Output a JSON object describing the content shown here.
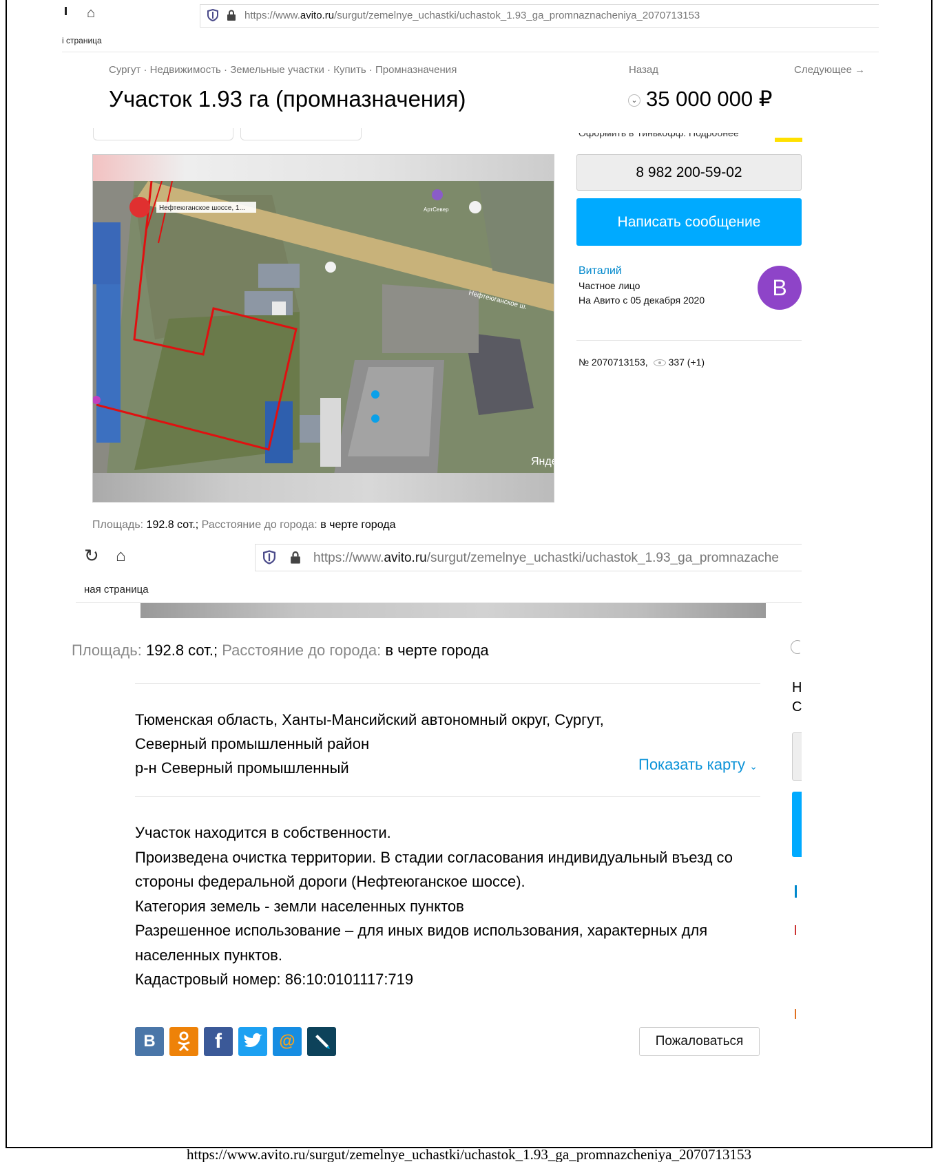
{
  "top": {
    "url_prefix": "https://www.",
    "url_host": "avito.ru",
    "url_path": "/surgut/zemelnye_uchastki/uchastok_1.93_ga_promnaznacheniya_2070713153",
    "bookmark": "і страница",
    "breadcrumb": "Сургут · Недвижимость · Земельные участки · Купить · Промназначения",
    "nav_back": "Назад",
    "nav_next": "Следующее →",
    "title": "Участок 1.93 га (промназначения)",
    "price": "35 000 000 ₽",
    "phone_button": "8 982 200-59-02",
    "message_button": "Написать сообщение",
    "seller_name": "Виталий",
    "seller_type": "Частное лицо",
    "seller_since": "На Авито с 05 декабря 2020",
    "ad_number": "№ 2070713153,",
    "views": "337 (+1)",
    "partial_text": "Оформить в Тинькофф. Подробнее",
    "avatar_letter": "В",
    "map_labels": {
      "place": "Нефтеюганское шоссе, 1...",
      "road": "Нефтеюганское ш.",
      "arts": "АртСевер",
      "watermark": "Янде"
    }
  },
  "params": {
    "area_label": "Площадь:",
    "area_value": "192.8 сот.",
    "sep": ";",
    "distance_label": "Расстояние до города:",
    "distance_value": "в черте города"
  },
  "bottom": {
    "url_prefix": "https://www.",
    "url_host": "avito.ru",
    "url_path": "/surgut/zemelnye_uchastki/uchastok_1.93_ga_promnazache",
    "bookmark": "ная страница",
    "address_lines": [
      "Тюменская область, Ханты-Мансийский автономный округ, Сургут,",
      "Северный промышленный район",
      "р-н Северный промышленный"
    ],
    "show_map": "Показать карту",
    "description_lines": [
      "Участок находится в собственности.",
      "Произведена очистка территории. В стадии согласования индивидуальный въезд со",
      "стороны федеральной дороги (Нефтеюганское шоссе).",
      "Категория земель - земли населенных пунктов",
      "Разрешенное использование – для иных видов использования, характерных для",
      "населенных пунктов.",
      "Кадастровый номер: 86:10:0101117:719"
    ],
    "report_button": "Пожаловаться",
    "share": [
      {
        "name": "vk",
        "glyph": "В",
        "color": "#4a76a8"
      },
      {
        "name": "ok",
        "glyph": "ꙮ",
        "color": "#ee8208"
      },
      {
        "name": "facebook",
        "glyph": "f",
        "color": "#3b5998"
      },
      {
        "name": "twitter",
        "glyph": "🐦",
        "color": "#1da1f2"
      },
      {
        "name": "mailru",
        "glyph": "@",
        "color": "#168de2"
      },
      {
        "name": "livejournal",
        "glyph": "✎",
        "color": "#0d425a"
      }
    ]
  },
  "caption": "https://www.avito.ru/surgut/zemelnye_uchastki/uchastok_1.93_ga_promnazcheniya_2070713153",
  "colors": {
    "accent_blue": "#00aaff",
    "link_blue": "#0088cc",
    "avatar": "#8e44c8",
    "plot_boundary": "#e01010"
  }
}
